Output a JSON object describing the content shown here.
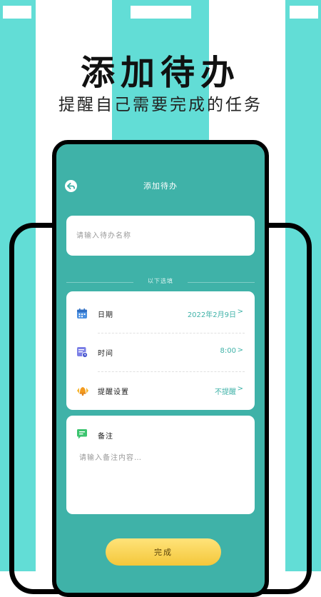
{
  "promo": {
    "headline": "添加待办",
    "subline": "提醒自己需要完成的任务"
  },
  "screen": {
    "title": "添加待办",
    "back_icon": "back-arrow-icon",
    "name_placeholder": "请输入待办名称",
    "options_divider": "以下选填",
    "options": [
      {
        "icon": "calendar-icon",
        "label": "日期",
        "value": "2022年2月9日"
      },
      {
        "icon": "clock-icon",
        "label": "时间",
        "value": "8:00"
      },
      {
        "icon": "bell-icon",
        "label": "提醒设置",
        "value": "不提醒"
      }
    ],
    "chevron": ">",
    "note": {
      "icon": "note-icon",
      "label": "备注",
      "placeholder": "请输入备注内容…"
    },
    "done_label": "完成"
  },
  "colors": {
    "stripe": "#62ddd6",
    "app_bg": "#3fb2a8",
    "accent": "#3fb2a8",
    "button": "#f4c73a"
  }
}
